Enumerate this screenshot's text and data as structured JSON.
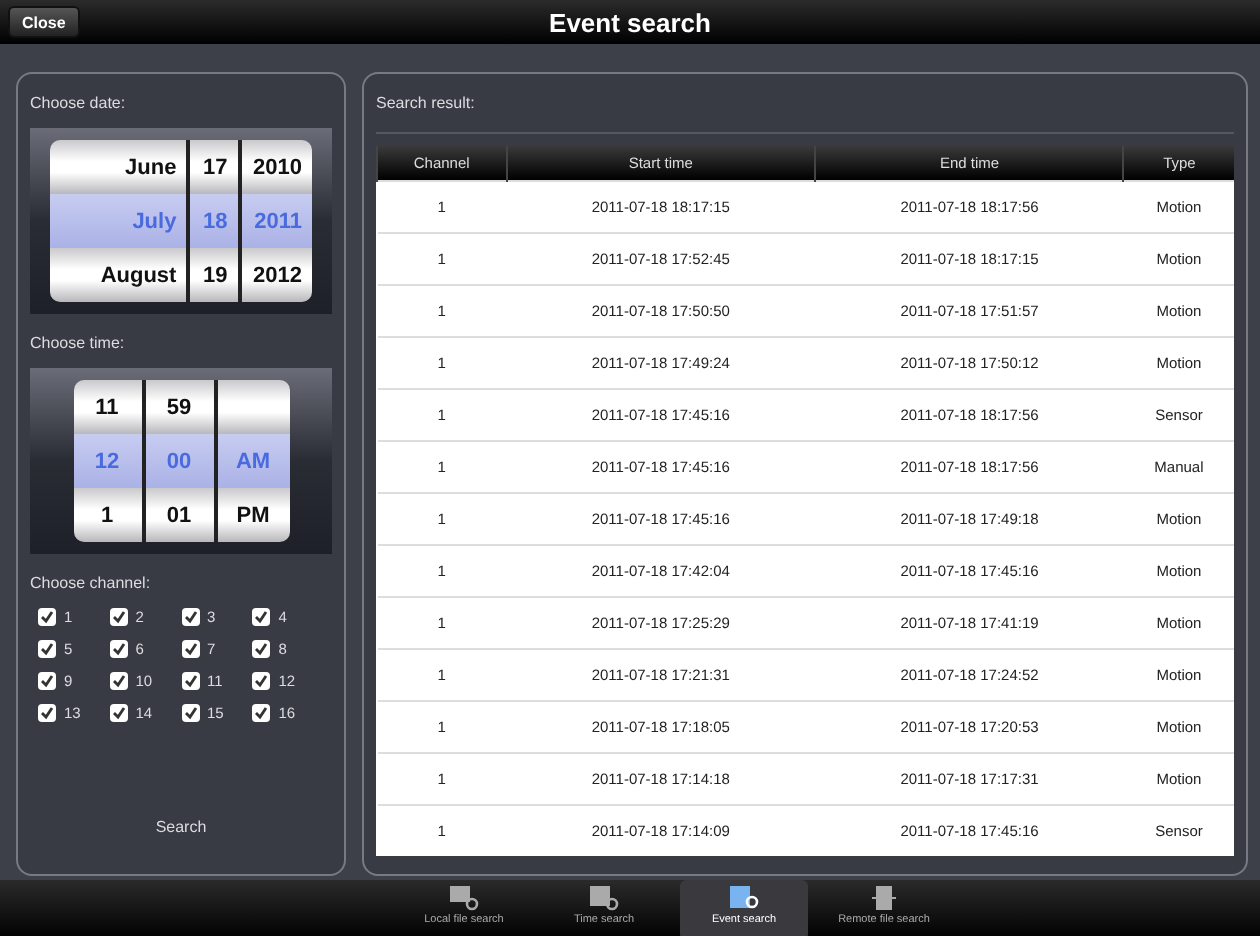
{
  "window": {
    "title": "Event search",
    "close_button": "Close"
  },
  "date_picker": {
    "label": "Choose date:",
    "rows": [
      {
        "cells": [
          "June",
          "17",
          "2010"
        ],
        "selected": false
      },
      {
        "cells": [
          "July",
          "18",
          "2011"
        ],
        "selected": true
      },
      {
        "cells": [
          "August",
          "19",
          "2012"
        ],
        "selected": false
      }
    ]
  },
  "time_picker": {
    "label": "Choose time:",
    "rows": [
      {
        "cells": [
          "11",
          "59"
        ],
        "selected": false
      },
      {
        "cells": [
          "12",
          "00",
          "AM"
        ],
        "selected": true
      },
      {
        "cells": [
          "1",
          "01",
          "PM"
        ],
        "selected": false
      }
    ]
  },
  "channels": {
    "label": "Choose channel:",
    "items": [
      {
        "label": "1",
        "checked": true
      },
      {
        "label": "2",
        "checked": true
      },
      {
        "label": "3",
        "checked": true
      },
      {
        "label": "4",
        "checked": true
      },
      {
        "label": "5",
        "checked": true
      },
      {
        "label": "6",
        "checked": true
      },
      {
        "label": "7",
        "checked": true
      },
      {
        "label": "8",
        "checked": true
      },
      {
        "label": "9",
        "checked": true
      },
      {
        "label": "10",
        "checked": true
      },
      {
        "label": "11",
        "checked": true
      },
      {
        "label": "12",
        "checked": true
      },
      {
        "label": "13",
        "checked": true
      },
      {
        "label": "14",
        "checked": true
      },
      {
        "label": "15",
        "checked": true
      },
      {
        "label": "16",
        "checked": true
      }
    ]
  },
  "search_button": "Search",
  "results": {
    "label": "Search result:",
    "columns": [
      "Channel",
      "Start time",
      "End time",
      "Type"
    ],
    "rows": [
      [
        "1",
        "2011-07-18 18:17:15",
        "2011-07-18 18:17:56",
        "Motion"
      ],
      [
        "1",
        "2011-07-18 17:52:45",
        "2011-07-18 18:17:15",
        "Motion"
      ],
      [
        "1",
        "2011-07-18 17:50:50",
        "2011-07-18 17:51:57",
        "Motion"
      ],
      [
        "1",
        "2011-07-18 17:49:24",
        "2011-07-18 17:50:12",
        "Motion"
      ],
      [
        "1",
        "2011-07-18 17:45:16",
        "2011-07-18 18:17:56",
        "Sensor"
      ],
      [
        "1",
        "2011-07-18 17:45:16",
        "2011-07-18 18:17:56",
        "Manual"
      ],
      [
        "1",
        "2011-07-18 17:45:16",
        "2011-07-18 17:49:18",
        "Motion"
      ],
      [
        "1",
        "2011-07-18 17:42:04",
        "2011-07-18 17:45:16",
        "Motion"
      ],
      [
        "1",
        "2011-07-18 17:25:29",
        "2011-07-18 17:41:19",
        "Motion"
      ],
      [
        "1",
        "2011-07-18 17:21:31",
        "2011-07-18 17:24:52",
        "Motion"
      ],
      [
        "1",
        "2011-07-18 17:18:05",
        "2011-07-18 17:20:53",
        "Motion"
      ],
      [
        "1",
        "2011-07-18 17:14:18",
        "2011-07-18 17:17:31",
        "Motion"
      ],
      [
        "1",
        "2011-07-18 17:14:09",
        "2011-07-18 17:45:16",
        "Sensor"
      ]
    ]
  },
  "tab_bar": [
    {
      "label": "Local file search",
      "kind": "local",
      "selected": false
    },
    {
      "label": "Time search",
      "kind": "time",
      "selected": false
    },
    {
      "label": "Event search",
      "kind": "event",
      "selected": true
    },
    {
      "label": "Remote file search",
      "kind": "remote",
      "selected": false
    }
  ]
}
